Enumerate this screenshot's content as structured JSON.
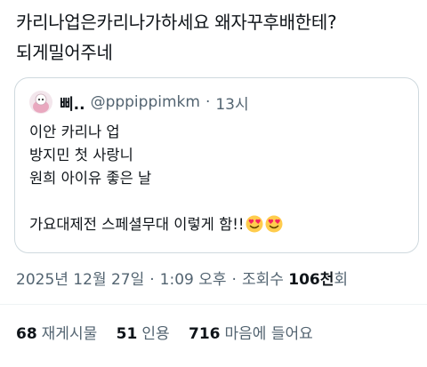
{
  "tweet": {
    "line1": "카리나업은카리나가하세요 왜자꾸후배한테?",
    "line2": "되게밀어주네"
  },
  "quote": {
    "display_name": "삐..",
    "handle": "@pppippimkm",
    "separator": "·",
    "time": "13시",
    "lines": [
      "이안 카리나 업",
      "방지민 첫 사랑니",
      "원희 아이유 좋은 날",
      "",
      "가요대제전 스페셜무대 이렇게 함!!"
    ],
    "emoji": [
      "heart-eyes-emoji",
      "heart-eyes-emoji"
    ]
  },
  "meta": {
    "date": "2025년 12월 27일",
    "separator": "·",
    "time": "1:09 오후",
    "views_label": "조회수",
    "views_count": "106천",
    "views_suffix": "회"
  },
  "stats": {
    "reposts_count": "68",
    "reposts_label": "재게시물",
    "quotes_count": "51",
    "quotes_label": "인용",
    "likes_count": "716",
    "likes_label": "마음에 들어요"
  },
  "colors": {
    "text": "#0f1419",
    "secondary": "#536471",
    "border": "#cfd9de",
    "emoji": "#ffcc4d",
    "heart": "#f4245e"
  }
}
